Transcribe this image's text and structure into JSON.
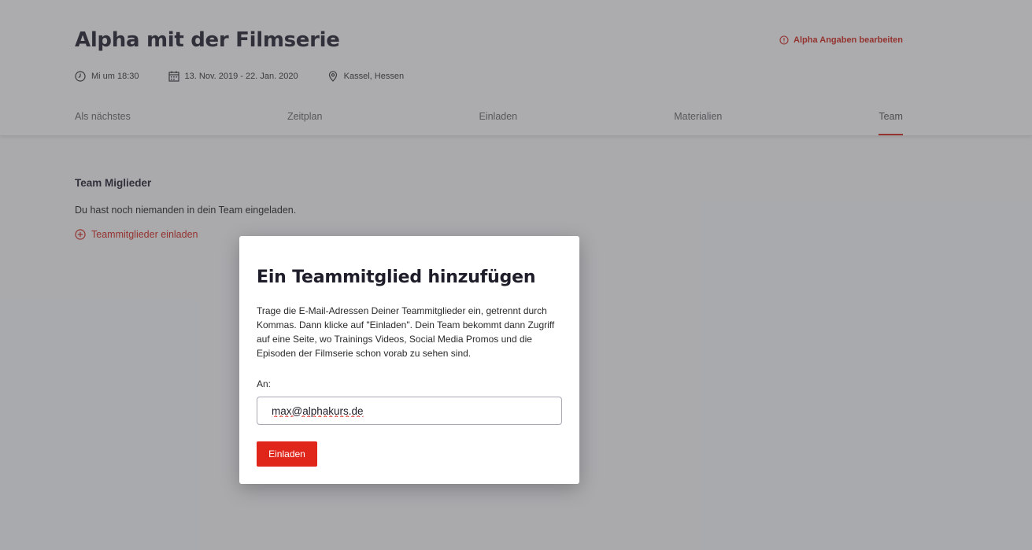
{
  "header": {
    "title": "Alpha mit der Filmserie",
    "edit_link": "Alpha Angaben bearbeiten",
    "meta": {
      "time": "Mi um 18:30",
      "dates": "13. Nov. 2019 - 22. Jan. 2020",
      "location": "Kassel, Hessen"
    },
    "tabs": [
      "Als nächstes",
      "Zeitplan",
      "Einladen",
      "Materialien",
      "Team"
    ],
    "active_tab": "Team"
  },
  "team_section": {
    "title": "Team Miglieder",
    "empty_text": "Du hast noch niemanden in dein Team eingeladen.",
    "invite_link": "Teammitglieder einladen"
  },
  "modal": {
    "title": "Ein Teammitglied hinzufügen",
    "description": "Trage die E-Mail-Adressen Deiner Teammitglieder ein, getrennt durch Kommas. Dann klicke auf \"Einladen\". Dein Team bekommt dann Zugriff auf eine Seite, wo Trainings Videos, Social Media Promos und die Episoden der Filmserie schon vorab zu sehen sind.",
    "field_label": "An:",
    "email_value": "max@alphakurs.de",
    "submit_label": "Einladen"
  },
  "colors": {
    "accent": "#e0251a",
    "text": "#1e1e2a",
    "overlay": "#46484e"
  },
  "icons": {
    "edit": "alert-circle-icon",
    "time": "clock-icon",
    "dates": "calendar-icon",
    "location": "map-pin-icon",
    "invite": "plus-circle-icon"
  }
}
